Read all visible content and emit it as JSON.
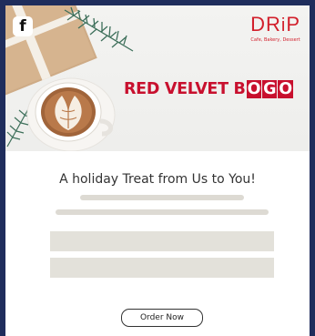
{
  "social": {
    "icon": "facebook-icon",
    "glyph": "f"
  },
  "brand": {
    "logo_prefix": "DR",
    "logo_i": "i",
    "logo_suffix": "P",
    "tagline": "Cafe, Bakery, Dessert",
    "color": "#d21f2b"
  },
  "hero": {
    "promo_prefix": "RED VELVET B",
    "promo_boxed": [
      "O",
      "G",
      "O"
    ]
  },
  "content": {
    "headline": "A holiday Treat from Us to You!"
  },
  "cta": {
    "label": "Order Now"
  },
  "colors": {
    "background": "#1f2d5c",
    "promo_red": "#c8102e",
    "placeholder": "#e3e1da"
  }
}
